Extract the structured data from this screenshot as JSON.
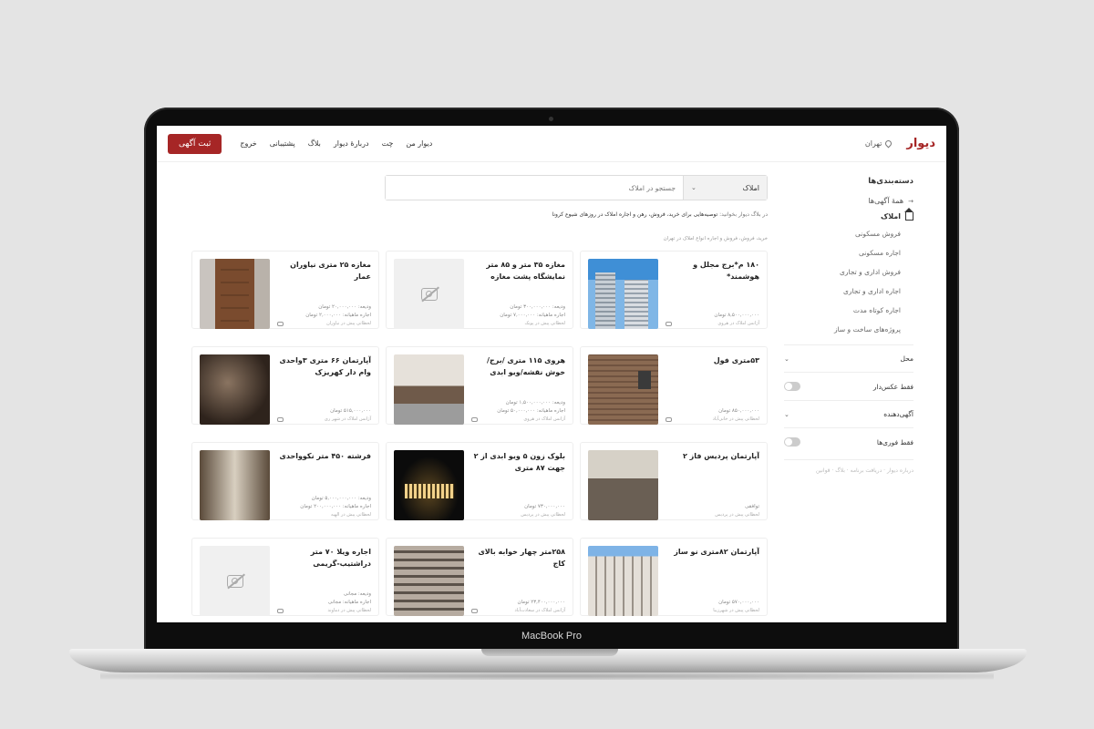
{
  "device": {
    "label": "MacBook Pro"
  },
  "header": {
    "logo": "دیوار",
    "city": "تهران",
    "nav": [
      "دیوار من",
      "چت",
      "دربارهٔ دیوار",
      "بلاگ",
      "پشتیبانی",
      "خروج"
    ],
    "post_button": "ثبت آگهی"
  },
  "search": {
    "category": "املاک",
    "placeholder": "جستجو در املاک"
  },
  "intro": {
    "prefix": "در بلاگ دیوار بخوانید:",
    "text": "توصیه‌هایی برای خرید، فروش، رهن و اجاره املاک در روزهای شیوع کرونا"
  },
  "breadcrumb": "خرید، فروش، فروش و اجاره انواع املاک در تهران",
  "sidebar": {
    "title": "دسته‌بندی‌ها",
    "all": "همهٔ آگهی‌ها",
    "category": "املاک",
    "subcategories": [
      "فروش مسکونی",
      "اجاره مسکونی",
      "فروش اداری و تجاری",
      "اجاره اداری و تجاری",
      "اجاره کوتاه مدت",
      "پروژه‌های ساخت و ساز"
    ],
    "filters": [
      {
        "label": "محل",
        "type": "expand"
      },
      {
        "label": "فقط عکس‌دار",
        "type": "toggle"
      },
      {
        "label": "آگهی‌دهنده",
        "type": "expand"
      },
      {
        "label": "فقط فوری‌ها",
        "type": "toggle"
      }
    ],
    "footer": "درباره دیوار · دریافت برنامه · بلاگ · قوانین"
  },
  "listings": [
    {
      "title": "۱۸۰ م*برج مجلل و هوشمند*",
      "lines": [
        "۸,۵۰۰,۰۰۰,۰۰۰ تومان"
      ],
      "foot": "آژانس املاک در هروی",
      "photo": "p-towers",
      "chat": true
    },
    {
      "title": "مغازه ۳۵ متر و ۸۵ متر نمایشگاه پشت مغازه",
      "lines": [
        "ودیعه: ۳۰۰,۰۰۰,۰۰۰ تومان",
        "اجاره ماهیانه: ۷,۰۰۰,۰۰۰ تومان"
      ],
      "foot": "لحظاتی پیش در پونک",
      "photo": "",
      "chat": false
    },
    {
      "title": "مغازه ۲۵ متری نیاوران عمار",
      "lines": [
        "ودیعه: ۲۰,۰۰۰,۰۰۰ تومان",
        "اجاره ماهیانه: ۲,۰۰۰,۰۰۰ تومان"
      ],
      "foot": "لحظاتی پیش در نیاوران",
      "photo": "p-door",
      "chat": true
    },
    {
      "title": "۵۳متری فول",
      "lines": [
        "۸۵۰,۰۰۰,۰۰۰ تومان"
      ],
      "foot": "لحظاتی پیش در خانی‌آباد",
      "photo": "p-brick",
      "chat": true
    },
    {
      "title": "هروی ۱۱۵ متری /برج/خوش نقشه/ویو ابدی",
      "lines": [
        "ودیعه: ۱,۵۰۰,۰۰۰,۰۰۰ تومان",
        "اجاره ماهیانه: ۵۰,۰۰۰,۰۰۰ تومان"
      ],
      "foot": "آژانس املاک در هروی",
      "photo": "p-kitchen",
      "chat": true
    },
    {
      "title": "آپارتمان ۶۶ متری ۳واحدی وام دار کهریزک",
      "lines": [
        "۵۱۵,۰۰۰,۰۰۰ تومان"
      ],
      "foot": "آژانس املاک در شهر ری",
      "photo": "p-lobby",
      "chat": true
    },
    {
      "title": "آپارتمان پردیس فاز ۲",
      "lines": [
        "توافقی"
      ],
      "foot": "لحظاتی پیش در پردیس",
      "photo": "p-office",
      "chat": false
    },
    {
      "title": "بلوک زون ۵ ویو ابدی از ۲ جهت ۸۷ متری",
      "lines": [
        "۷۳۰,۰۰۰,۰۰۰ تومان"
      ],
      "foot": "لحظاتی پیش در پردیس",
      "photo": "p-night",
      "chat": false
    },
    {
      "title": "فرشته ۴۵۰ متر نکوواحدی",
      "lines": [
        "ودیعه: ۵,۰۰۰,۰۰۰,۰۰۰ تومان",
        "اجاره ماهیانه: ۲۰۰,۰۰۰,۰۰۰ تومان"
      ],
      "foot": "لحظاتی پیش در الهیه",
      "photo": "p-hall",
      "chat": false
    },
    {
      "title": "آپارتمان ۸۲متری نو ساز",
      "lines": [
        "۵۷۰,۰۰۰,۰۰۰ تومان"
      ],
      "foot": "لحظاتی پیش در شهرزیبا",
      "photo": "p-facade2",
      "chat": false
    },
    {
      "title": "۲۵۸متر چهار خوابه بالای کاج",
      "lines": [
        "۲۳,۴۰۰,۰۰۰,۰۰۰ تومان"
      ],
      "foot": "آژانس املاک در سعادت‌آباد",
      "photo": "p-facade",
      "chat": true
    },
    {
      "title": "اجاره ویلا ۷۰ متر دراشتیب-گریمی",
      "lines": [
        "ودیعه: مجانی",
        "اجاره ماهیانه: مجانی"
      ],
      "foot": "لحظاتی پیش در دماوند",
      "photo": "",
      "chat": true
    }
  ]
}
